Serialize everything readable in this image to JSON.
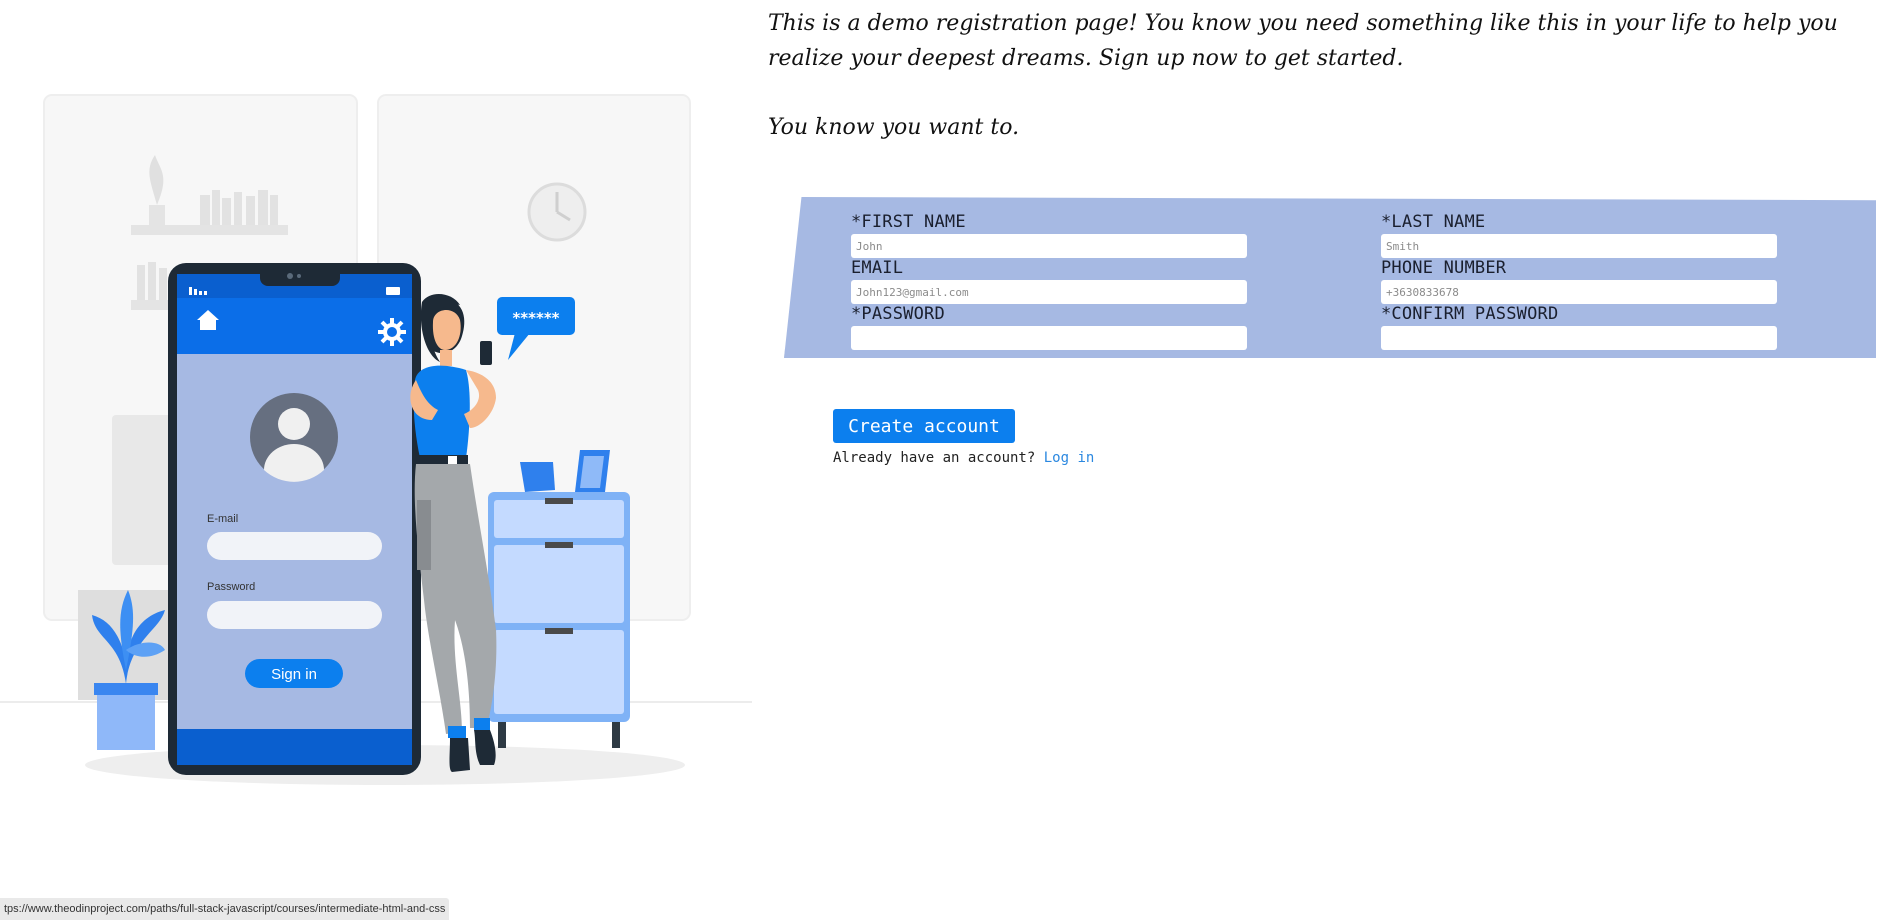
{
  "intro": {
    "line1": "This is a demo registration page! You know you need something like this in your life to help you realize your deepest dreams. Sign up now to get started.",
    "line2": "You know you want to."
  },
  "form": {
    "first_name": {
      "label": "*FIRST NAME",
      "placeholder": "John",
      "value": ""
    },
    "last_name": {
      "label": "*LAST NAME",
      "placeholder": "Smith",
      "value": ""
    },
    "email": {
      "label": "EMAIL",
      "placeholder": "John123@gmail.com",
      "value": ""
    },
    "phone": {
      "label": "PHONE NUMBER",
      "placeholder": "+3630833678",
      "value": ""
    },
    "password": {
      "label": "*PASSWORD",
      "placeholder": "",
      "value": ""
    },
    "confirm_password": {
      "label": "*CONFIRM PASSWORD",
      "placeholder": "",
      "value": ""
    }
  },
  "actions": {
    "create_label": "Create account",
    "login_prompt": "Already have an account?",
    "login_link": "Log in"
  },
  "illustration": {
    "phone_email_label": "E-mail",
    "phone_password_label": "Password",
    "phone_signin_label": "Sign in",
    "speech_bubble_text": "******"
  },
  "status_bar": {
    "url": "tps://www.theodinproject.com/paths/full-stack-javascript/courses/intermediate-html-and-css"
  },
  "colors": {
    "accent_blue": "#0c7fee",
    "form_background": "#a6b9e3",
    "link": "#2b88e0"
  }
}
